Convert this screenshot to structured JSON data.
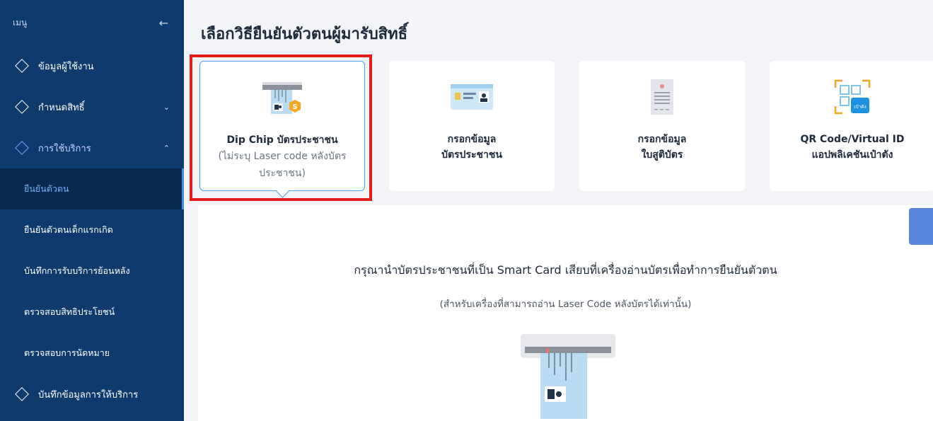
{
  "sidebar": {
    "title": "เมนู",
    "items": [
      {
        "label": "ข้อมูลผู้ใช้งาน"
      },
      {
        "label": "กำหนดสิทธิ์"
      },
      {
        "label": "การใช้บริการ"
      }
    ],
    "subitems": [
      {
        "label": "ยืนยันตัวตน"
      },
      {
        "label": "ยืนยันตัวตนเด็กแรกเกิด"
      },
      {
        "label": "บันทึกการรับบริการย้อนหลัง"
      },
      {
        "label": "ตรวจสอบสิทธิประโยชน์"
      },
      {
        "label": "ตรวจสอบการนัดหมาย"
      }
    ],
    "bottom_item": {
      "label": "บันทึกข้อมูลการให้บริการ"
    }
  },
  "main": {
    "title": "เลือกวิธียืนยันตัวตนผู้มารับสิทธิ์",
    "cards": [
      {
        "line1": "Dip Chip บัตรประชาชน",
        "sub": "(ไม่ระบุ Laser code หลังบัตรประชาชน)",
        "icon": "card-reader-icon"
      },
      {
        "line1": "กรอกข้อมูล",
        "line2": "บัตรประชาชน",
        "icon": "id-card-icon"
      },
      {
        "line1": "กรอกข้อมูล",
        "line2": "ใบสูติบัตร",
        "icon": "birth-certificate-icon"
      },
      {
        "line1": "QR Code/Virtual ID",
        "line2": "แอปพลิเคชันเป๋าตัง",
        "icon": "qr-code-icon"
      }
    ],
    "instruction": "กรุณานำบัตรประชาชนที่เป็น Smart Card เสียบที่เครื่องอ่านบัตรเพื่อทำการยืนยันตัวตน",
    "note": "(สำหรับเครื่องที่สามารถอ่าน Laser Code หลังบัตรได้เท่านั้น)",
    "badge_letter": "S",
    "app_badge": "เป๋าตัง"
  },
  "colors": {
    "sidebar_bg": "#0d3b6e",
    "active_sub_bg": "#0a2a4d",
    "active_text": "#6fb4ff",
    "selected_border": "#4aa3e8",
    "highlight_frame": "#e21b1b"
  }
}
